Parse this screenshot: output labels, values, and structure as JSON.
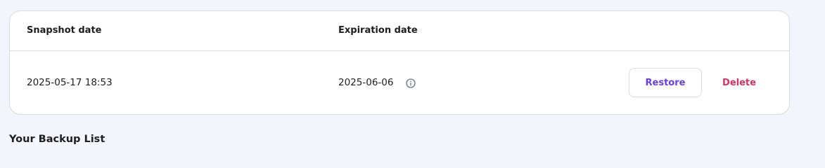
{
  "snapshot_table": {
    "columns": {
      "snapshot_date": "Snapshot date",
      "expiration_date": "Expiration date"
    },
    "rows": [
      {
        "snapshot_date": "2025-05-17 18:53",
        "expiration_date": "2025-06-06",
        "info_icon": "info-circle-icon",
        "restore_label": "Restore",
        "delete_label": "Delete"
      }
    ]
  },
  "backup_section": {
    "title": "Your Backup List"
  },
  "colors": {
    "page_background": "#f4f4fc",
    "card_background": "#ffffff",
    "border": "#dadce0",
    "text": "#1d1e20",
    "restore_accent": "#673de6",
    "delete_accent": "#d63163",
    "icon": "#6d7081"
  }
}
